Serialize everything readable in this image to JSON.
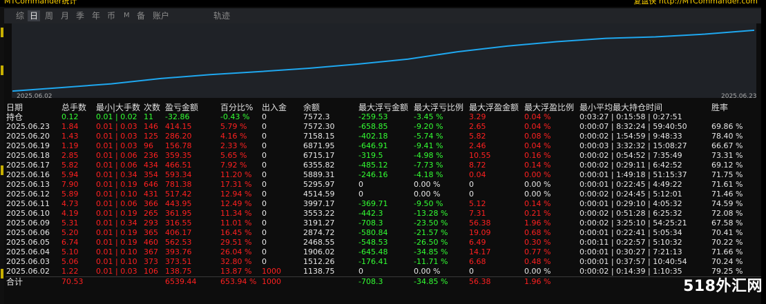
{
  "window": {
    "app_title": "MTCommander统计",
    "right_title": "复盘侠 http://MTCommander.com"
  },
  "tabs": [
    {
      "label": "综",
      "active": false
    },
    {
      "label": "日",
      "active": true
    },
    {
      "label": "周",
      "active": false
    },
    {
      "label": "月",
      "active": false
    },
    {
      "label": "季",
      "active": false
    },
    {
      "label": "年",
      "active": false
    },
    {
      "label": "币",
      "active": false
    },
    {
      "label": "M",
      "active": false
    },
    {
      "label": "备",
      "active": false
    },
    {
      "label": "账户",
      "active": false
    }
  ],
  "chart_tab": "轨迹",
  "chart_data": {
    "type": "line",
    "x_start": "2025.06.02",
    "x_end": "2025.06.23",
    "line_color": "#1fa8f0",
    "x": [
      "2025.06.02",
      "2025.06.03",
      "2025.06.04",
      "2025.06.05",
      "2025.06.06",
      "2025.06.09",
      "2025.06.10",
      "2025.06.11",
      "2025.06.12",
      "2025.06.13",
      "2025.06.16",
      "2025.06.17",
      "2025.06.18",
      "2025.06.19",
      "2025.06.20",
      "2025.06.23"
    ],
    "values": [
      1138.75,
      1512.26,
      1906.02,
      2468.55,
      2874.72,
      3191.27,
      3553.22,
      3997.17,
      4514.59,
      5295.97,
      5889.31,
      6355.82,
      6715.17,
      6871.95,
      7158.15,
      7572.3
    ],
    "ylim": [
      1000,
      8000
    ],
    "grid": false
  },
  "table": {
    "headers": [
      "日期",
      "总手数",
      "最小|大手数",
      "次数",
      "盈亏金额",
      "百分比%",
      "出入金",
      "余额",
      "最大浮亏金额",
      "最大浮亏比例",
      "最大浮盈金额",
      "最大浮盈比例",
      "最小平均最大持仓时间",
      "胜率"
    ],
    "holding": {
      "label": "持仓",
      "lots": "0.12",
      "minmax": "0.01 | 0.02",
      "count": "11",
      "pnl": "-32.86",
      "pct": "-0.43 %",
      "deposit": "0",
      "balance": "7572.3",
      "max_float_loss": "-259.53",
      "max_float_loss_pct": "-3.45 %",
      "max_float_profit": "3.29",
      "max_float_profit_pct": "0.04 %",
      "hold_time": "0:03:27 | 0:15:58 | 0:27:51",
      "win_rate": ""
    },
    "rows": [
      {
        "date": "2025.06.23",
        "lots": "1.84",
        "minmax": "0.01 | 0.03",
        "count": "146",
        "pnl": "414.15",
        "pct": "5.79 %",
        "deposit": "0",
        "balance": "7572.30",
        "mfl": "-658.85",
        "mflp": "-9.20 %",
        "mfp": "2.65",
        "mfpp": "0.04 %",
        "time": "0:00:07 | 8:32:24 | 59:40:50",
        "win": "69.86 %"
      },
      {
        "date": "2025.06.20",
        "lots": "1.43",
        "minmax": "0.01 | 0.03",
        "count": "125",
        "pnl": "286.20",
        "pct": "4.16 %",
        "deposit": "0",
        "balance": "7158.15",
        "mfl": "-402.18",
        "mflp": "-5.74 %",
        "mfp": "5.82",
        "mfpp": "0.08 %",
        "time": "0:00:02 | 1:54:59 | 9:48:33",
        "win": "78.40 %"
      },
      {
        "date": "2025.06.19",
        "lots": "1.19",
        "minmax": "0.01 | 0.03",
        "count": "96",
        "pnl": "156.78",
        "pct": "2.33 %",
        "deposit": "0",
        "balance": "6871.95",
        "mfl": "-646.91",
        "mflp": "-9.41 %",
        "mfp": "2.46",
        "mfpp": "0.04 %",
        "time": "0:00:03 | 3:32:32 | 15:08:27",
        "win": "66.67 %"
      },
      {
        "date": "2025.06.18",
        "lots": "2.85",
        "minmax": "0.01 | 0.06",
        "count": "236",
        "pnl": "359.35",
        "pct": "5.65 %",
        "deposit": "0",
        "balance": "6715.17",
        "mfl": "-319.5",
        "mflp": "-4.98 %",
        "mfp": "10.55",
        "mfpp": "0.16 %",
        "time": "0:00:02 | 0:54:52 | 7:35:49",
        "win": "73.31 %"
      },
      {
        "date": "2025.06.17",
        "lots": "5.82",
        "minmax": "0.01 | 0.06",
        "count": "434",
        "pnl": "466.51",
        "pct": "7.92 %",
        "deposit": "0",
        "balance": "6355.82",
        "mfl": "-485.12",
        "mflp": "-7.73 %",
        "mfp": "8.72",
        "mfpp": "0.14 %",
        "time": "0:00:02 | 0:29:11 | 6:42:52",
        "win": "69.12 %"
      },
      {
        "date": "2025.06.16",
        "lots": "5.94",
        "minmax": "0.01 | 0.34",
        "count": "354",
        "pnl": "593.34",
        "pct": "11.20 %",
        "deposit": "0",
        "balance": "5889.31",
        "mfl": "-246.16",
        "mflp": "-4.18 %",
        "mfp": "0.04",
        "mfpp": "0.00 %",
        "time": "0:00:01 | 1:49:18 | 51:15:37",
        "win": "71.75 %"
      },
      {
        "date": "2025.06.13",
        "lots": "7.90",
        "minmax": "0.01 | 0.19",
        "count": "646",
        "pnl": "781.38",
        "pct": "17.31 %",
        "deposit": "0",
        "balance": "5295.97",
        "mfl": "0",
        "mflp": "0.00 %",
        "mfp": "0",
        "mfpp": "0.00 %",
        "time": "0:00:01 | 0:22:45 | 4:49:22",
        "win": "71.61 %"
      },
      {
        "date": "2025.06.12",
        "lots": "5.89",
        "minmax": "0.01 | 0.10",
        "count": "431",
        "pnl": "517.42",
        "pct": "12.94 %",
        "deposit": "0",
        "balance": "4514.59",
        "mfl": "0",
        "mflp": "0.00 %",
        "mfp": "0",
        "mfpp": "0.00 %",
        "time": "0:00:02 | 0:24:45 | 5:12:01",
        "win": "71.46 %"
      },
      {
        "date": "2025.06.11",
        "lots": "4.73",
        "minmax": "0.01 | 0.06",
        "count": "366",
        "pnl": "443.95",
        "pct": "12.49 %",
        "deposit": "0",
        "balance": "3997.17",
        "mfl": "-369.71",
        "mflp": "-9.50 %",
        "mfp": "5.12",
        "mfpp": "0.14 %",
        "time": "0:00:01 | 0:29:10 | 4:05:32",
        "win": "74.59 %"
      },
      {
        "date": "2025.06.10",
        "lots": "4.19",
        "minmax": "0.01 | 0.19",
        "count": "265",
        "pnl": "361.95",
        "pct": "11.34 %",
        "deposit": "0",
        "balance": "3553.22",
        "mfl": "-442.3",
        "mflp": "-13.28 %",
        "mfp": "7.31",
        "mfpp": "0.21 %",
        "time": "0:00:02 | 0:51:28 | 6:25:32",
        "win": "72.08 %"
      },
      {
        "date": "2025.06.09",
        "lots": "5.31",
        "minmax": "0.01 | 0.34",
        "count": "293",
        "pnl": "316.55",
        "pct": "11.01 %",
        "deposit": "0",
        "balance": "3191.27",
        "mfl": "-708.3",
        "mflp": "-23.50 %",
        "mfp": "56.38",
        "mfpp": "1.96 %",
        "time": "0:00:02 | 3:25:10 | 54:25:21",
        "win": "67.58 %"
      },
      {
        "date": "2025.06.06",
        "lots": "5.20",
        "minmax": "0.01 | 0.19",
        "count": "365",
        "pnl": "406.17",
        "pct": "16.45 %",
        "deposit": "0",
        "balance": "2874.72",
        "mfl": "-580.84",
        "mflp": "-21.57 %",
        "mfp": "19.09",
        "mfpp": "0.68 %",
        "time": "0:00:01 | 0:22:41 | 5:05:34",
        "win": "70.41 %"
      },
      {
        "date": "2025.06.05",
        "lots": "6.74",
        "minmax": "0.01 | 0.19",
        "count": "460",
        "pnl": "562.53",
        "pct": "29.51 %",
        "deposit": "0",
        "balance": "2468.55",
        "mfl": "-548.53",
        "mflp": "-26.50 %",
        "mfp": "6.49",
        "mfpp": "0.30 %",
        "time": "0:00:11 | 0:22:57 | 5:10:32",
        "win": "70.22 %"
      },
      {
        "date": "2025.06.04",
        "lots": "5.10",
        "minmax": "0.01 | 0.10",
        "count": "367",
        "pnl": "393.76",
        "pct": "26.04 %",
        "deposit": "0",
        "balance": "1906.02",
        "mfl": "-645.48",
        "mflp": "-34.85 %",
        "mfp": "14.17",
        "mfpp": "0.77 %",
        "time": "0:00:01 | 0:30:27 | 7:21:13",
        "win": "71.66 %"
      },
      {
        "date": "2025.06.03",
        "lots": "5.06",
        "minmax": "0.01 | 0.10",
        "count": "373",
        "pnl": "373.51",
        "pct": "32.80 %",
        "deposit": "0",
        "balance": "1512.26",
        "mfl": "-176.41",
        "mflp": "-11.71 %",
        "mfp": "6.68",
        "mfpp": "0.48 %",
        "time": "0:00:01 | 0:37:57 | 10:40:54",
        "win": "70.24 %"
      },
      {
        "date": "2025.06.02",
        "lots": "1.22",
        "minmax": "0.01 | 0.03",
        "count": "106",
        "pnl": "138.75",
        "pct": "13.87 %",
        "deposit": "1000",
        "balance": "1138.75",
        "mfl": "0",
        "mflp": "0.00 %",
        "mfp": "0",
        "mfpp": "0.00 %",
        "time": "0:00:02 | 0:14:39 | 1:10:35",
        "win": "79.25 %"
      }
    ],
    "total": {
      "label": "合计",
      "lots": "70.53",
      "pnl": "6539.44",
      "pct": "653.94 %",
      "deposit": "1000",
      "mfl": "-708.3",
      "mflp": "-34.85 %",
      "mfp": "56.38",
      "mfpp": "1.96 %"
    }
  },
  "watermark": "518外汇网"
}
